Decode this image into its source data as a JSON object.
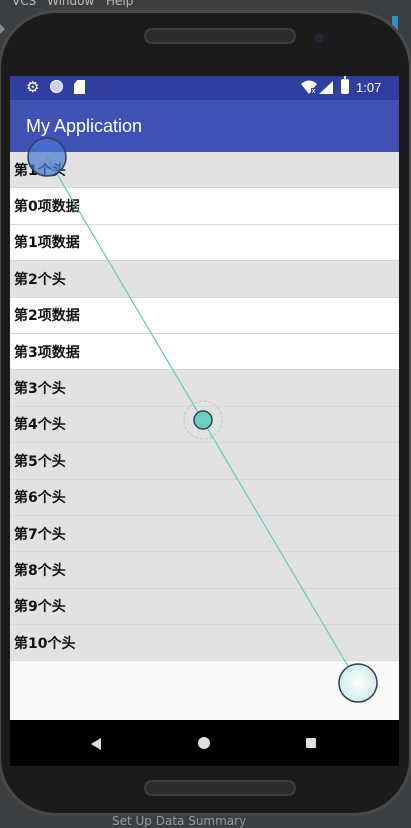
{
  "ide": {
    "menu": [
      "VCS",
      "Window",
      "Help"
    ],
    "bottom_text": "Set Up Data Summary",
    "accent_color": "#3592c4"
  },
  "status_bar": {
    "time": "1:07",
    "icons": [
      "gear-icon",
      "circle-icon",
      "sd-card-icon",
      "wifi-icon",
      "signal-icon",
      "battery-icon"
    ],
    "color": "#303f9f"
  },
  "app_bar": {
    "title": "My Application",
    "color": "#3f51b5"
  },
  "list": {
    "rows": [
      {
        "type": "header",
        "label": "第1个头"
      },
      {
        "type": "item",
        "label": "第0项数据"
      },
      {
        "type": "item",
        "label": "第1项数据"
      },
      {
        "type": "header",
        "label": "第2个头"
      },
      {
        "type": "item",
        "label": "第2项数据"
      },
      {
        "type": "item",
        "label": "第3项数据"
      },
      {
        "type": "header",
        "label": "第3个头"
      },
      {
        "type": "header",
        "label": "第4个头"
      },
      {
        "type": "header",
        "label": "第5个头"
      },
      {
        "type": "header",
        "label": "第6个头"
      },
      {
        "type": "header",
        "label": "第7个头"
      },
      {
        "type": "header",
        "label": "第8个头"
      },
      {
        "type": "header",
        "label": "第9个头"
      },
      {
        "type": "header",
        "label": "第10个头"
      }
    ],
    "header_color": "#e2e2e2",
    "item_color": "#ffffff"
  },
  "nav_bar": {
    "icons": [
      "back-icon",
      "home-icon",
      "recents-icon"
    ]
  },
  "gesture": {
    "line_color": "#5ec9bd",
    "mid_color": "#6dcfc2"
  }
}
